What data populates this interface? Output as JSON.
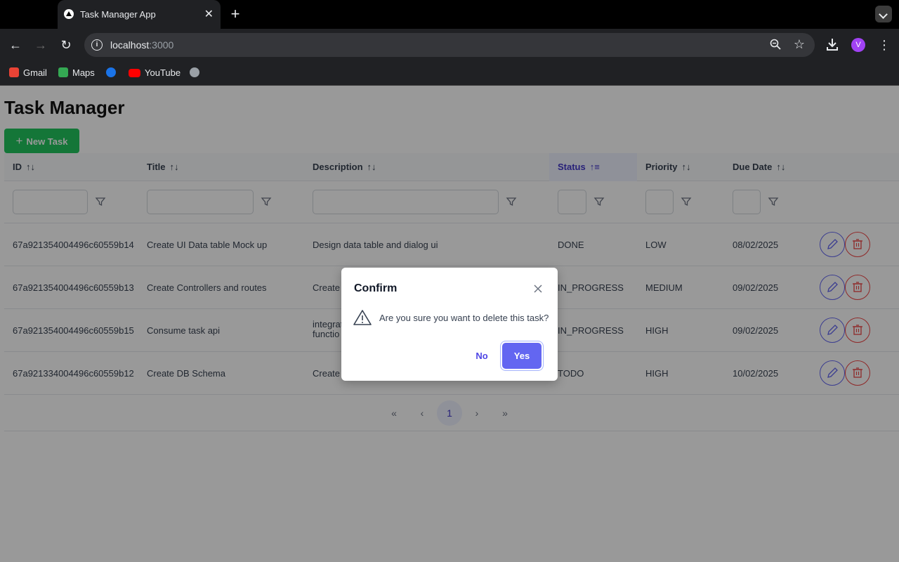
{
  "browser": {
    "tab_title": "Task Manager App",
    "tab_close": "✕",
    "new_tab": "+",
    "url_host": "localhost",
    "url_port": ":3000",
    "profile_initial": "V",
    "bookmarks": [
      {
        "label": "Gmail",
        "color": "#ea4335"
      },
      {
        "label": "Maps",
        "color": "#34a853"
      },
      {
        "label": "",
        "color": "#1a73e8"
      },
      {
        "label": "YouTube",
        "color": "#ff0000"
      },
      {
        "label": "",
        "color": "#9aa0a6"
      }
    ]
  },
  "page": {
    "title": "Task Manager",
    "new_task_label": "New Task",
    "columns": [
      {
        "label": "ID",
        "sort_icon": "sort-icon"
      },
      {
        "label": "Title",
        "sort_icon": "sort-icon"
      },
      {
        "label": "Description",
        "sort_icon": "sort-icon"
      },
      {
        "label": "Status",
        "sort_icon": "sort-asc-icon",
        "active": true
      },
      {
        "label": "Priority",
        "sort_icon": "sort-icon"
      },
      {
        "label": "Due Date",
        "sort_icon": "sort-icon"
      }
    ],
    "rows": [
      {
        "id": "67a921354004496c60559b14",
        "title": "Create UI Data table Mock up",
        "description": "Design data table and dialog ui",
        "status": "DONE",
        "priority": "LOW",
        "due": "08/02/2025"
      },
      {
        "id": "67a921354004496c60559b13",
        "title": "Create Controllers and routes",
        "description": "Create",
        "status": "IN_PROGRESS",
        "priority": "MEDIUM",
        "due": "09/02/2025"
      },
      {
        "id": "67a921354004496c60559b15",
        "title": "Consume task api",
        "description_line1": "integrat",
        "description_line2": "functio",
        "status": "IN_PROGRESS",
        "priority": "HIGH",
        "due": "09/02/2025"
      },
      {
        "id": "67a921334004496c60559b12",
        "title": "Create DB Schema",
        "description": "Create",
        "status": "TODO",
        "priority": "HIGH",
        "due": "10/02/2025"
      }
    ],
    "pager": {
      "first": "«",
      "prev": "‹",
      "current": "1",
      "next": "›",
      "last": "»"
    }
  },
  "dialog": {
    "title": "Confirm",
    "message": "Are you sure you want to delete this task?",
    "no_label": "No",
    "yes_label": "Yes"
  },
  "colors": {
    "accent": "#6366f1",
    "success": "#22c55e",
    "danger": "#ef4444"
  }
}
